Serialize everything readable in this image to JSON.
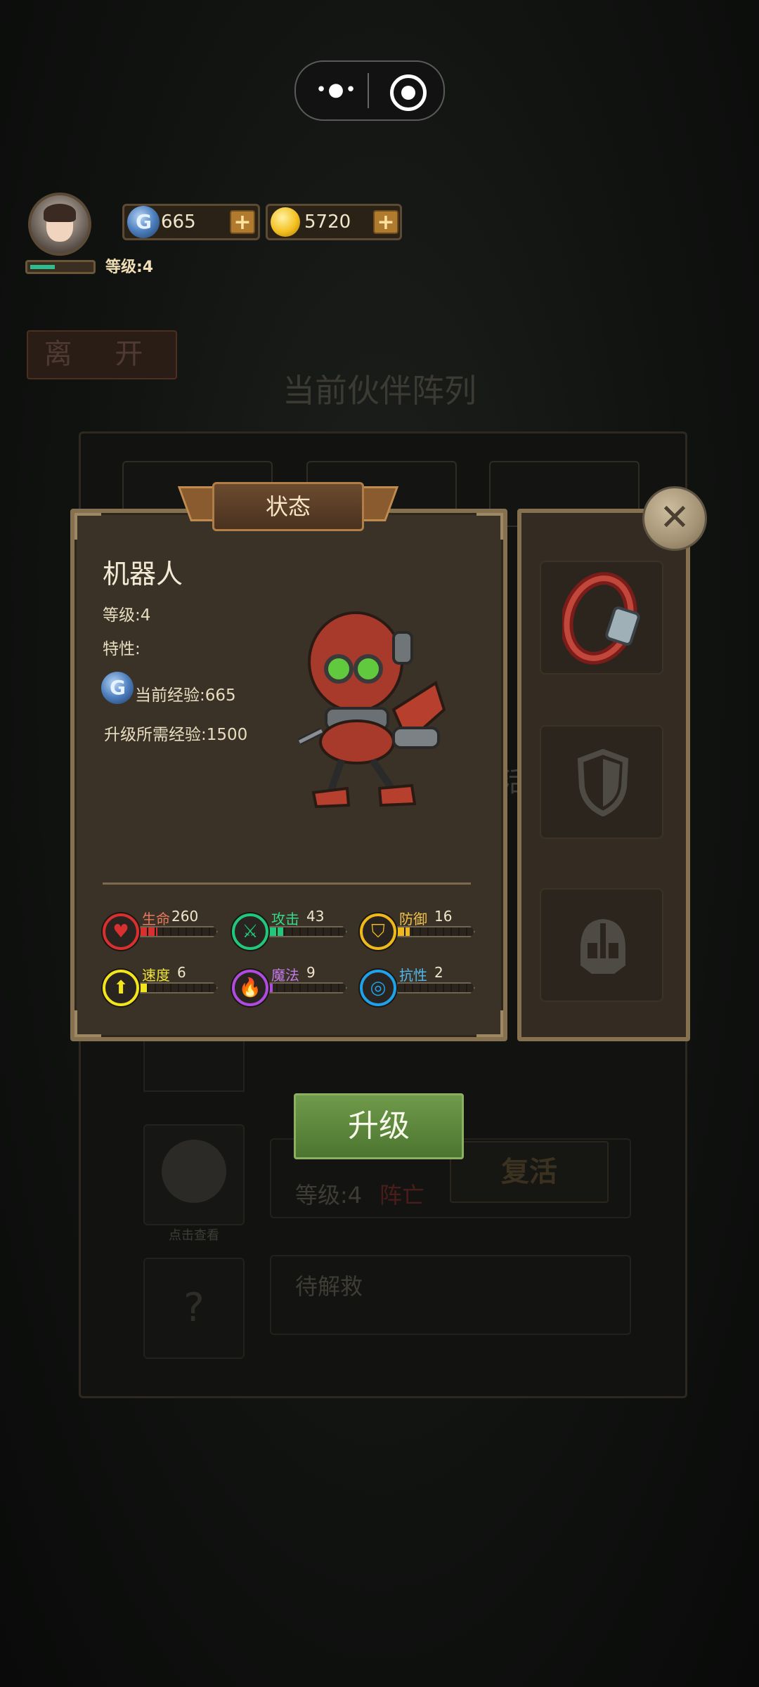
{
  "top_capsule": {
    "menu_icon": "more-dots-icon",
    "close_icon": "target-circle-icon"
  },
  "player": {
    "level_text": "等级:4",
    "xp_progress": 0.4,
    "gems": "665",
    "gold": "5720"
  },
  "background": {
    "leave_label": "离 开",
    "title": "当前伙伴阵列",
    "revive_hint": "复活",
    "partner_level": "等级:4",
    "partner_status": "阵亡",
    "view_hint": "点击查看",
    "unknown_mark": "?",
    "pending_label": "待解救",
    "faded_text": "活"
  },
  "dialog": {
    "banner_title": "状态",
    "character_name": "机器人",
    "level_line": "等级:4",
    "trait_line": "特性:",
    "current_exp_line": "当前经验:665",
    "required_exp_line": "升级所需经验:1500",
    "stats": [
      {
        "label": "生命",
        "value": "260",
        "fill": 0.22,
        "color": "#d8302e",
        "label_color": "#e8795f",
        "icon": "heart-icon",
        "glyph": "♥"
      },
      {
        "label": "攻击",
        "value": "43",
        "fill": 0.18,
        "color": "#21c77a",
        "label_color": "#37d98a",
        "icon": "sword-icon",
        "glyph": "⚔"
      },
      {
        "label": "防御",
        "value": "16",
        "fill": 0.16,
        "color": "#f0b91a",
        "label_color": "#f2c24a",
        "icon": "shield-icon",
        "glyph": "⛉"
      },
      {
        "label": "速度",
        "value": "6",
        "fill": 0.08,
        "color": "#f3e51c",
        "label_color": "#efe23a",
        "icon": "speed-arrow-icon",
        "glyph": "⬆"
      },
      {
        "label": "魔法",
        "value": "9",
        "fill": 0.04,
        "color": "#b04be0",
        "label_color": "#c27be8",
        "icon": "flame-icon",
        "glyph": "🔥"
      },
      {
        "label": "抗性",
        "value": "2",
        "fill": 0.0,
        "color": "#1fa2e8",
        "label_color": "#4fb9ef",
        "icon": "ring-icon",
        "glyph": "◎"
      }
    ],
    "upgrade_label": "升级",
    "equipment_slots": [
      "bracelet-icon",
      "shield-icon",
      "helmet-icon"
    ]
  }
}
